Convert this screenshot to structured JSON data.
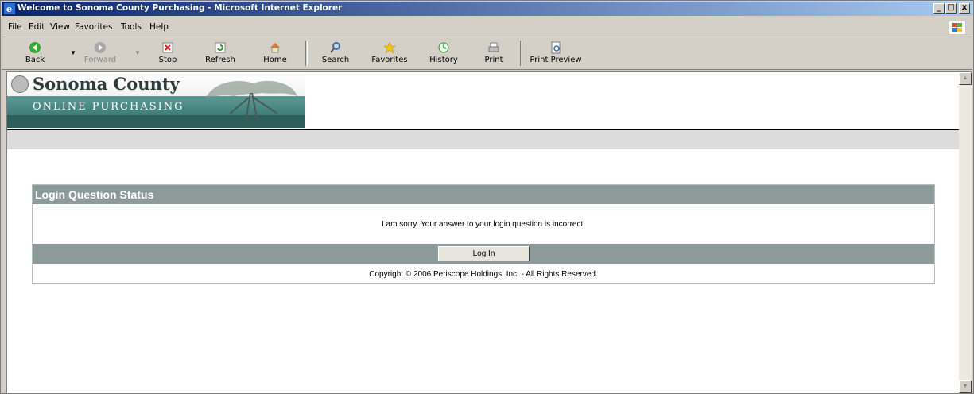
{
  "window": {
    "title": "Welcome to Sonoma County Purchasing - Microsoft Internet Explorer",
    "minimize": "_",
    "maximize": "□",
    "close": "x"
  },
  "menu": [
    {
      "label": "File"
    },
    {
      "label": "Edit"
    },
    {
      "label": "View"
    },
    {
      "label": "Favorites"
    },
    {
      "label": "Tools"
    },
    {
      "label": "Help"
    }
  ],
  "toolbar": {
    "back": "Back",
    "forward": "Forward",
    "stop": "Stop",
    "refresh": "Refresh",
    "home": "Home",
    "search": "Search",
    "favorites": "Favorites",
    "history": "History",
    "print": "Print",
    "print_preview": "Print Preview"
  },
  "banner": {
    "title": "Sonoma County",
    "subtitle": "ONLINE PURCHASING"
  },
  "panel": {
    "heading": "Login Question Status",
    "message": "I am sorry. Your answer to your login question is incorrect.",
    "button": "Log In",
    "copyright": "Copyright © 2006 Periscope Holdings, Inc. - All Rights Reserved."
  },
  "colors": {
    "titlebar_start": "#0a246a",
    "panel_header": "#8c9a9a",
    "banner_teal": "#4f8c88"
  }
}
